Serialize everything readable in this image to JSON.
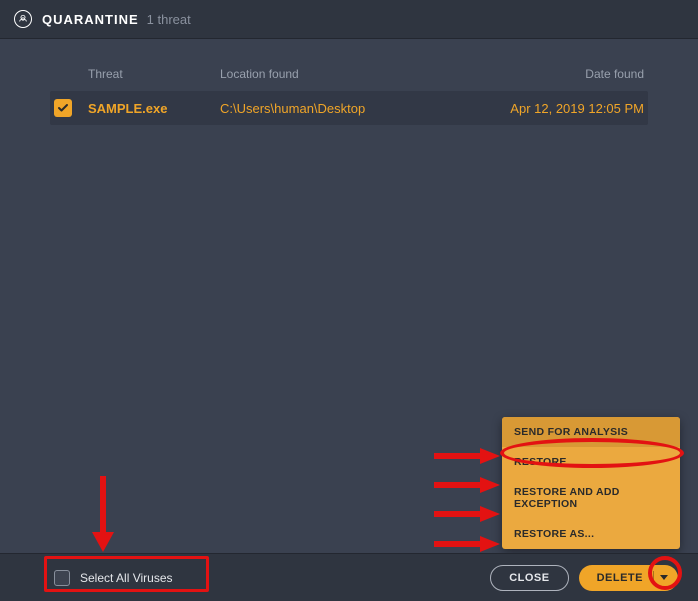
{
  "header": {
    "title": "QUARANTINE",
    "count": "1 threat"
  },
  "columns": {
    "threat": "Threat",
    "location": "Location found",
    "date": "Date found"
  },
  "row": {
    "name": "SAMPLE.exe",
    "location": "C:\\Users\\human\\Desktop",
    "date": "Apr 12, 2019 12:05 PM"
  },
  "footer": {
    "selectAll": "Select All Viruses",
    "close": "CLOSE",
    "delete": "DELETE"
  },
  "menu": {
    "sendForAnalysis": "SEND FOR ANALYSIS",
    "restore": "RESTORE",
    "restoreAddException": "RESTORE AND ADD EXCEPTION",
    "restoreAs": "RESTORE AS..."
  }
}
